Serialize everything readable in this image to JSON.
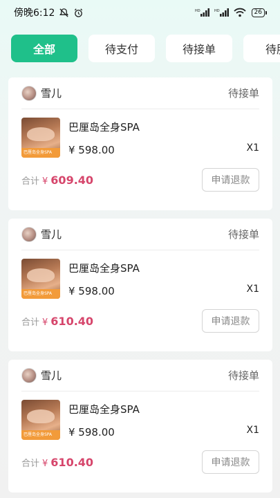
{
  "status_bar": {
    "time": "傍晚6:12",
    "icons_left": [
      "mute-icon",
      "alarm-icon"
    ],
    "signal1": "HD",
    "signal2": "HD",
    "battery": "26"
  },
  "tabs": [
    {
      "label": "全部",
      "active": true
    },
    {
      "label": "待支付",
      "active": false
    },
    {
      "label": "待接单",
      "active": false
    },
    {
      "label": "待服",
      "active": false
    }
  ],
  "orders": [
    {
      "user": "雪儿",
      "status": "待接单",
      "product_name": "巴厘岛全身SPA",
      "price": "¥ 598.00",
      "qty": "X1",
      "thumb_label": "巴厘岛全身SPA",
      "total_label": "合计",
      "total_yen": "¥",
      "total_amount": "609.40",
      "refund_label": "申请退款"
    },
    {
      "user": "雪儿",
      "status": "待接单",
      "product_name": "巴厘岛全身SPA",
      "price": "¥ 598.00",
      "qty": "X1",
      "thumb_label": "巴厘岛全身SPA",
      "total_label": "合计",
      "total_yen": "¥",
      "total_amount": "610.40",
      "refund_label": "申请退款"
    },
    {
      "user": "雪儿",
      "status": "待接单",
      "product_name": "巴厘岛全身SPA",
      "price": "¥ 598.00",
      "qty": "X1",
      "thumb_label": "巴厘岛全身SPA",
      "total_label": "合计",
      "total_yen": "¥",
      "total_amount": "610.40",
      "refund_label": "申请退款"
    }
  ],
  "colors": {
    "accent": "#1fc08a",
    "price_red": "#d6456b"
  }
}
